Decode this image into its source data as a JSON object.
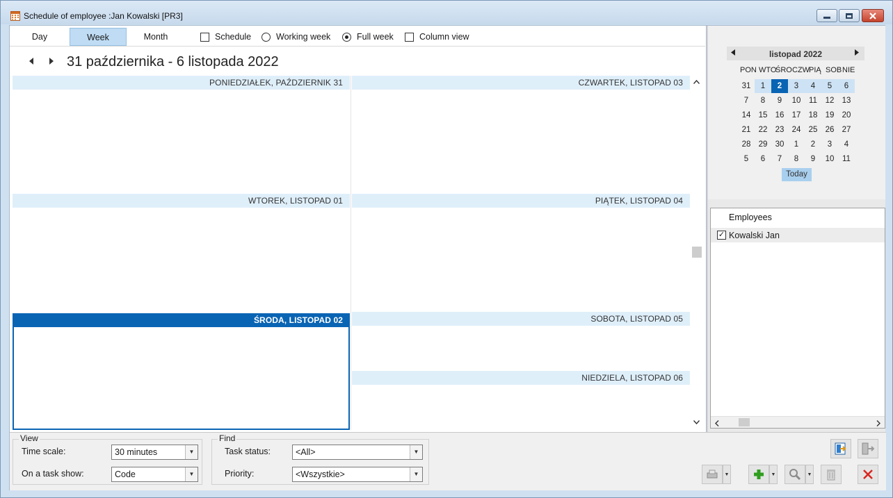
{
  "window": {
    "title": "Schedule of employee :Jan Kowalski [PR3]"
  },
  "viewbar": {
    "tabs": [
      {
        "label": "Day",
        "active": false
      },
      {
        "label": "Week",
        "active": true
      },
      {
        "label": "Month",
        "active": false
      }
    ],
    "schedule_label": "Schedule",
    "schedule_checked": false,
    "working_week_label": "Working week",
    "working_week_selected": false,
    "full_week_label": "Full week",
    "full_week_selected": true,
    "column_view_label": "Column view",
    "column_view_checked": false
  },
  "navigation": {
    "date_range": "31 października - 6 listopada 2022",
    "prev_icon": "triangle-left-icon",
    "next_icon": "triangle-right-icon"
  },
  "week": {
    "days": [
      {
        "label": "PONIEDZIAŁEK, PAŹDZIERNIK 31",
        "selected": false
      },
      {
        "label": "WTOREK, LISTOPAD 01",
        "selected": false
      },
      {
        "label": "ŚRODA, LISTOPAD 02",
        "selected": true
      },
      {
        "label": "CZWARTEK, LISTOPAD 03",
        "selected": false
      },
      {
        "label": "PIĄTEK, LISTOPAD 04",
        "selected": false
      },
      {
        "label": "SOBOTA, LISTOPAD 05",
        "selected": false
      },
      {
        "label": "NIEDZIELA, LISTOPAD 06",
        "selected": false
      }
    ]
  },
  "calendar": {
    "month_title": "listopad 2022",
    "weekdays": [
      "PON",
      "WTO",
      "ŚRO",
      "CZW",
      "PIĄ",
      "SOB",
      "NIE"
    ],
    "weeks": [
      [
        "31",
        "1",
        "2",
        "3",
        "4",
        "5",
        "6"
      ],
      [
        "7",
        "8",
        "9",
        "10",
        "11",
        "12",
        "13"
      ],
      [
        "14",
        "15",
        "16",
        "17",
        "18",
        "19",
        "20"
      ],
      [
        "21",
        "22",
        "23",
        "24",
        "25",
        "26",
        "27"
      ],
      [
        "28",
        "29",
        "30",
        "1",
        "2",
        "3",
        "4"
      ],
      [
        "5",
        "6",
        "7",
        "8",
        "9",
        "10",
        "11"
      ]
    ],
    "today_label": "Today",
    "today_value": "2",
    "colors": {
      "selected_week": "#cde3f5",
      "today": "#0a64b4"
    }
  },
  "employees": {
    "header": "Employees",
    "items": [
      {
        "name": "Kowalski Jan",
        "checked": true
      }
    ]
  },
  "bottom": {
    "view_group": {
      "legend": "View",
      "time_scale_label": "Time scale:",
      "time_scale_value": "30 minutes",
      "task_show_label": "On a task show:",
      "task_show_value": "Code"
    },
    "find_group": {
      "legend": "Find",
      "task_status_label": "Task status:",
      "task_status_value": "<All>",
      "priority_label": "Priority:",
      "priority_value": "<Wszystkie>"
    }
  },
  "accent": "#0a64b4"
}
